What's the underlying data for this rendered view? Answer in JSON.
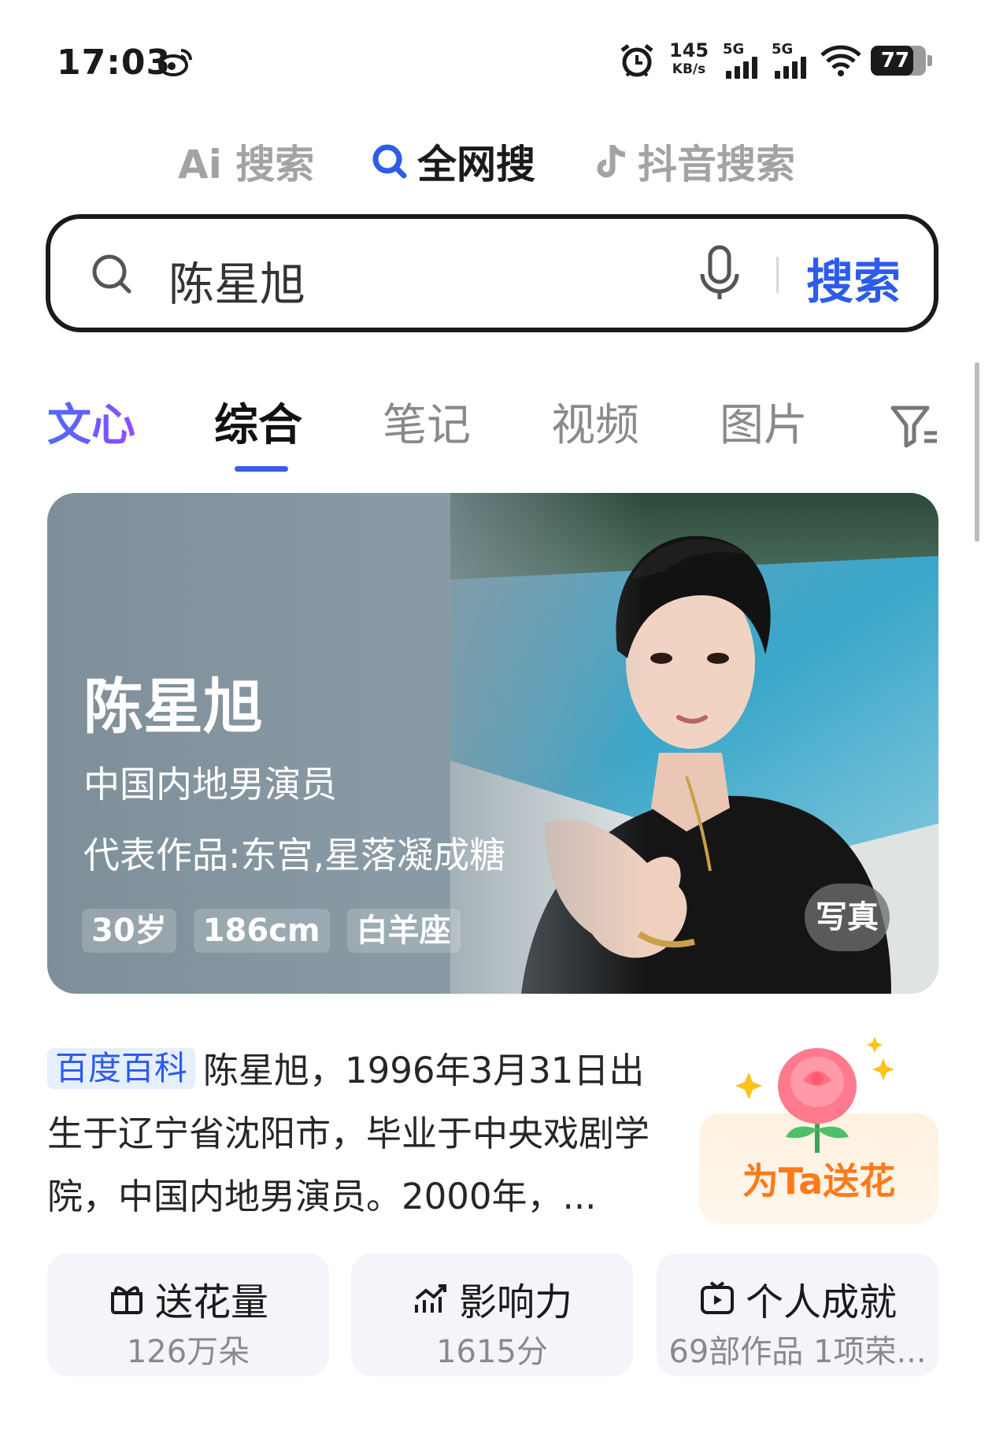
{
  "status_bar": {
    "time": "17:03",
    "net_speed_value": "145",
    "net_speed_unit": "KB/s",
    "sim1_label": "5G",
    "sim2_label": "5G",
    "battery_level": "77",
    "icons": [
      "weibo-icon",
      "alarm-icon",
      "signal-icon",
      "wifi-icon",
      "battery-icon"
    ]
  },
  "mode_tabs": [
    {
      "label": "Ai 搜索",
      "icon": "ai-icon",
      "active": false
    },
    {
      "label": "全网搜",
      "icon": "search-icon",
      "active": true
    },
    {
      "label": "抖音搜索",
      "icon": "douyin-icon",
      "active": false
    }
  ],
  "search": {
    "query": "陈星旭",
    "button_label": "搜索",
    "accent_color": "#2d5bea"
  },
  "category_tabs": [
    {
      "label": "文心",
      "active": false
    },
    {
      "label": "综合",
      "active": true
    },
    {
      "label": "笔记",
      "active": false
    },
    {
      "label": "视频",
      "active": false
    },
    {
      "label": "图片",
      "active": false
    }
  ],
  "hero": {
    "name": "陈星旭",
    "subtitle": "中国内地男演员",
    "works": "代表作品:东宫,星落凝成糖",
    "tags": [
      "30岁",
      "186cm",
      "白羊座"
    ],
    "photo_button": "写真"
  },
  "baike": {
    "tag": "百度百科",
    "text": "陈星旭，1996年3月31日出生于辽宁省沈阳市，毕业于中央戏剧学院，中国内地男演员。2000年，..."
  },
  "flower": {
    "label": "为Ta送花"
  },
  "stats": [
    {
      "title": "送花量",
      "value": "126万朵",
      "icon": "gift-icon"
    },
    {
      "title": "影响力",
      "value": "1615分",
      "icon": "trend-icon"
    },
    {
      "title": "个人成就",
      "value": "69部作品 1项荣...",
      "icon": "video-icon"
    }
  ]
}
